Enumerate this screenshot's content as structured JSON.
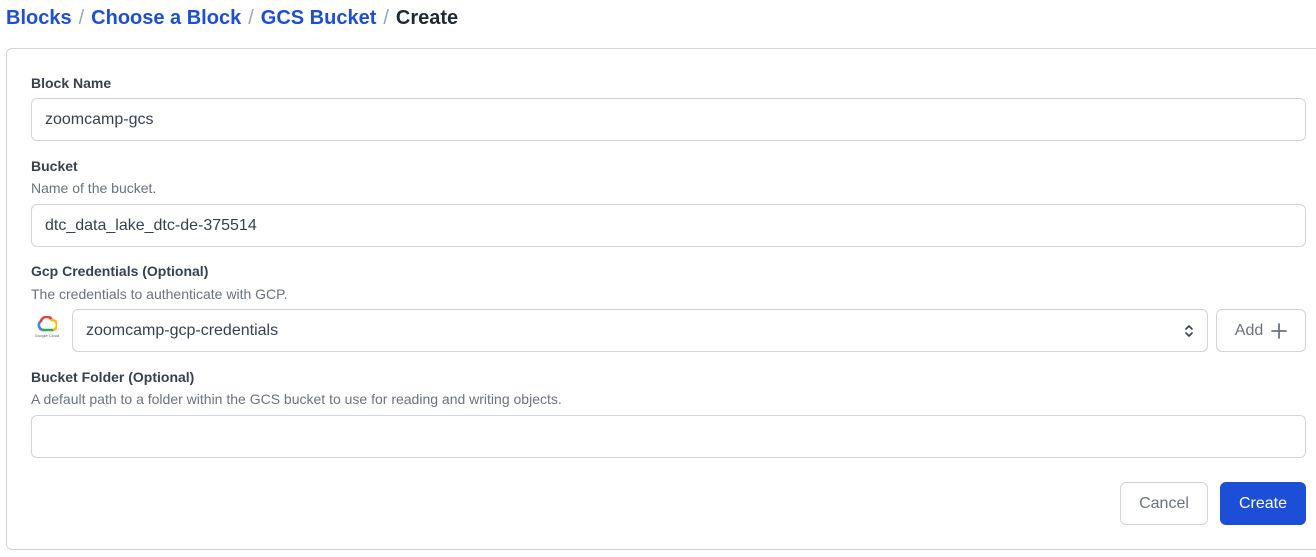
{
  "breadcrumb": {
    "items": [
      "Blocks",
      "Choose a Block",
      "GCS Bucket"
    ],
    "current": "Create",
    "separator": "/"
  },
  "form": {
    "block_name": {
      "label": "Block Name",
      "value": "zoomcamp-gcs"
    },
    "bucket": {
      "label": "Bucket",
      "description": "Name of the bucket.",
      "value": "dtc_data_lake_dtc-de-375514"
    },
    "gcp_credentials": {
      "label": "Gcp Credentials (Optional)",
      "description": "The credentials to authenticate with GCP.",
      "selected": "zoomcamp-gcp-credentials",
      "logo_icon": "google-cloud-icon",
      "logo_text": "Google Cloud",
      "add_label": "Add"
    },
    "bucket_folder": {
      "label": "Bucket Folder (Optional)",
      "description": "A default path to a folder within the GCS bucket to use for reading and writing objects.",
      "value": ""
    }
  },
  "actions": {
    "cancel_label": "Cancel",
    "create_label": "Create"
  },
  "colors": {
    "link": "#1d4ed8",
    "primary": "#1d4ed8",
    "border": "#d1d5db",
    "muted": "#6b7280"
  }
}
